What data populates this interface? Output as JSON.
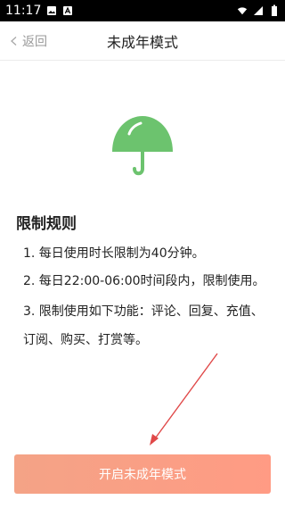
{
  "status_bar": {
    "time": "11:17",
    "left_icons": [
      "photo-icon",
      "a-icon"
    ],
    "right_icons": [
      "wifi-icon",
      "signal-icon",
      "battery-icon"
    ]
  },
  "header": {
    "back_label": "返回",
    "title": "未成年模式"
  },
  "illustration": {
    "icon": "umbrella-icon",
    "color": "#6cc36e"
  },
  "rules": {
    "title": "限制规则",
    "items": [
      "1. 每日使用时长限制为40分钟。",
      "2. 每日22:00-06:00时间段内，限制使用。",
      "3. 限制使用如下功能：评论、回复、充值、订阅、购买、打赏等。"
    ]
  },
  "cta": {
    "label": "开启未成年模式",
    "color_start": "#f4a386",
    "color_end": "#ff9b84"
  },
  "annotation": {
    "icon": "red-arrow-icon",
    "color": "#e04848"
  }
}
